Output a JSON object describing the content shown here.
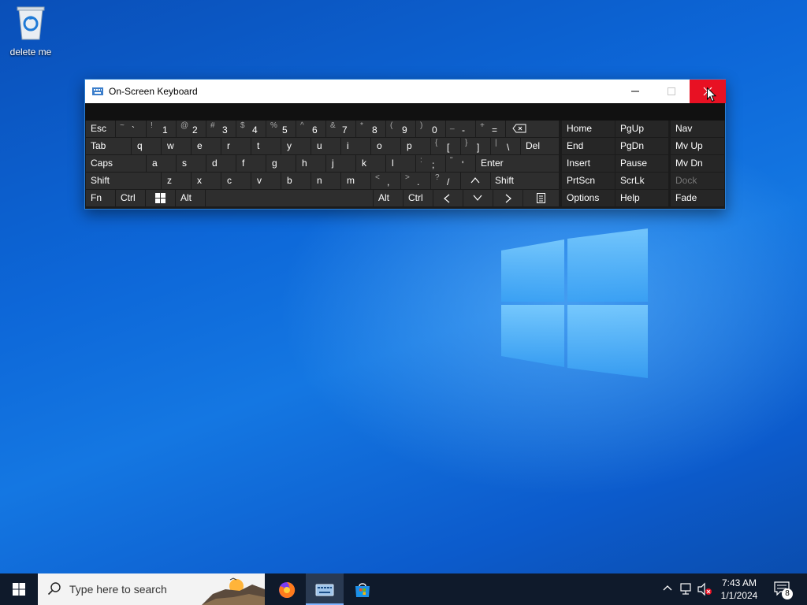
{
  "desktop": {
    "icons": [
      {
        "label": "delete me",
        "icon": "recycle-bin-icon"
      }
    ]
  },
  "osk": {
    "title": "On-Screen Keyboard",
    "title_icon": "keyboard-icon",
    "controls": {
      "minimize": "minimize-icon",
      "maximize": "maximize-icon",
      "close": "close-icon"
    },
    "close_color": "#e81123",
    "keys": {
      "esc": "Esc",
      "backtick_sh": "~",
      "backtick": "`",
      "n1_sh": "!",
      "n1": "1",
      "n2_sh": "@",
      "n2": "2",
      "n3_sh": "#",
      "n3": "3",
      "n4_sh": "$",
      "n4": "4",
      "n5_sh": "%",
      "n5": "5",
      "n6_sh": "^",
      "n6": "6",
      "n7_sh": "&",
      "n7": "7",
      "n8_sh": "*",
      "n8": "8",
      "n9_sh": "(",
      "n9": "9",
      "n0_sh": ")",
      "n0": "0",
      "minus_sh": "_",
      "minus": "-",
      "equal_sh": "+",
      "equal": "=",
      "tab": "Tab",
      "q": "q",
      "w": "w",
      "e": "e",
      "r": "r",
      "t": "t",
      "y": "y",
      "u": "u",
      "i": "i",
      "o": "o",
      "p": "p",
      "lbracket_sh": "{",
      "lbracket": "[",
      "rbracket_sh": "}",
      "rbracket": "]",
      "backslash_sh": "|",
      "backslash": "\\",
      "del": "Del",
      "caps": "Caps",
      "a": "a",
      "s": "s",
      "d": "d",
      "f": "f",
      "g": "g",
      "h": "h",
      "j": "j",
      "k": "k",
      "l": "l",
      "semicolon_sh": ":",
      "semicolon": ";",
      "quote_sh": "\"",
      "quote": "'",
      "enter": "Enter",
      "shift": "Shift",
      "z": "z",
      "x": "x",
      "c": "c",
      "v": "v",
      "b": "b",
      "n": "n",
      "m": "m",
      "comma_sh": "<",
      "comma": ",",
      "period_sh": ">",
      "period": ".",
      "slash_sh": "?",
      "slash": "/",
      "fn": "Fn",
      "ctrl": "Ctrl",
      "alt": "Alt",
      "home": "Home",
      "pgup": "PgUp",
      "nav": "Nav",
      "end": "End",
      "pgdn": "PgDn",
      "mvup": "Mv Up",
      "insert": "Insert",
      "pause": "Pause",
      "mvdn": "Mv Dn",
      "prtscn": "PrtScn",
      "scrlk": "ScrLk",
      "dock": "Dock",
      "options": "Options",
      "help": "Help",
      "fade": "Fade"
    }
  },
  "taskbar": {
    "search_placeholder": "Type here to search",
    "apps": [
      "firefox-icon",
      "on-screen-keyboard-icon",
      "microsoft-store-icon"
    ],
    "clock_time": "7:43 AM",
    "clock_date": "1/1/2024",
    "notification_count": "8"
  }
}
